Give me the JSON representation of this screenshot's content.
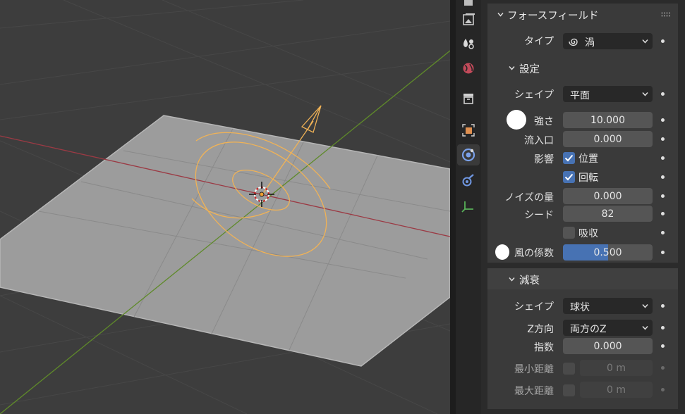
{
  "force_field": {
    "header": "フォースフィールド",
    "type_label": "タイプ",
    "type_value": "渦",
    "settings": {
      "header": "設定",
      "shape_label": "シェイプ",
      "shape_value": "平面",
      "strength_label": "強さ",
      "strength_value": "10.000",
      "inflow_label": "流入口",
      "inflow_value": "0.000",
      "affect_label": "影響",
      "affect_location_label": "位置",
      "affect_location_checked": true,
      "affect_rotation_label": "回転",
      "affect_rotation_checked": true,
      "noise_label": "ノイズの量",
      "noise_value": "0.000",
      "seed_label": "シード",
      "seed_value": "82",
      "absorption_label": "吸収",
      "absorption_checked": false,
      "wind_factor_label": "風の係数",
      "wind_factor_value": "0.500",
      "wind_factor_fraction": 0.5
    },
    "falloff": {
      "header": "減衰",
      "shape_label": "シェイプ",
      "shape_value": "球状",
      "z_direction_label": "Z方向",
      "z_direction_value": "両方のZ",
      "power_label": "指数",
      "power_value": "0.000",
      "min_distance_label": "最小距離",
      "min_distance_value": "0 m",
      "max_distance_label": "最大距離",
      "max_distance_value": "0 m"
    }
  },
  "colors": {
    "accent": "#4772b3",
    "x_axis": "#9b3a44",
    "y_axis": "#5f8a2a",
    "force_field_gizmo": "#f0b256"
  },
  "tabs": [
    "render-icon",
    "scene-icon",
    "world-icon",
    "collection-icon",
    "object-icon",
    "modifier-icon",
    "particles-icon",
    "physics-icon",
    "constraints-icon",
    "data-icon"
  ]
}
